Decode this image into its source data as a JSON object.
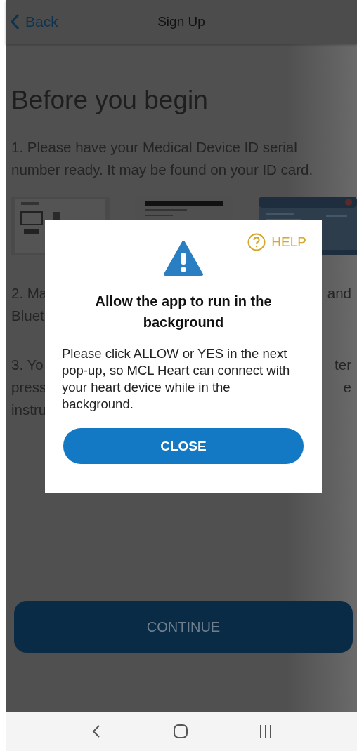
{
  "header": {
    "back": "Back",
    "title": "Sign Up"
  },
  "heading": "Before you begin",
  "step_1": "1. Please have your Medical Device ID serial number ready. It may be found on your ID card.",
  "steps_covered": [
    {
      "lines": [
        {
          "left": "2. Ma",
          "right": "and"
        },
        {
          "left": "Bluet"
        }
      ]
    },
    {
      "lines": [
        {
          "left": "3. Yo",
          "right": "ter"
        },
        {
          "left": "press",
          "right": "e"
        },
        {
          "left": "instru"
        }
      ]
    }
  ],
  "continue_button": {
    "label": "CONTINUE",
    "disabled": true
  },
  "dialog": {
    "help": "HELP",
    "title": "Allow the app to run in the background",
    "message": "Please click ALLOW or YES in the next pop-up, so MCL Heart can connect with your heart device while in the background.",
    "button": "CLOSE"
  },
  "nav_bar": {
    "buttons": [
      {
        "kind": "back"
      },
      {
        "kind": "home"
      },
      {
        "kind": "recents"
      }
    ]
  }
}
